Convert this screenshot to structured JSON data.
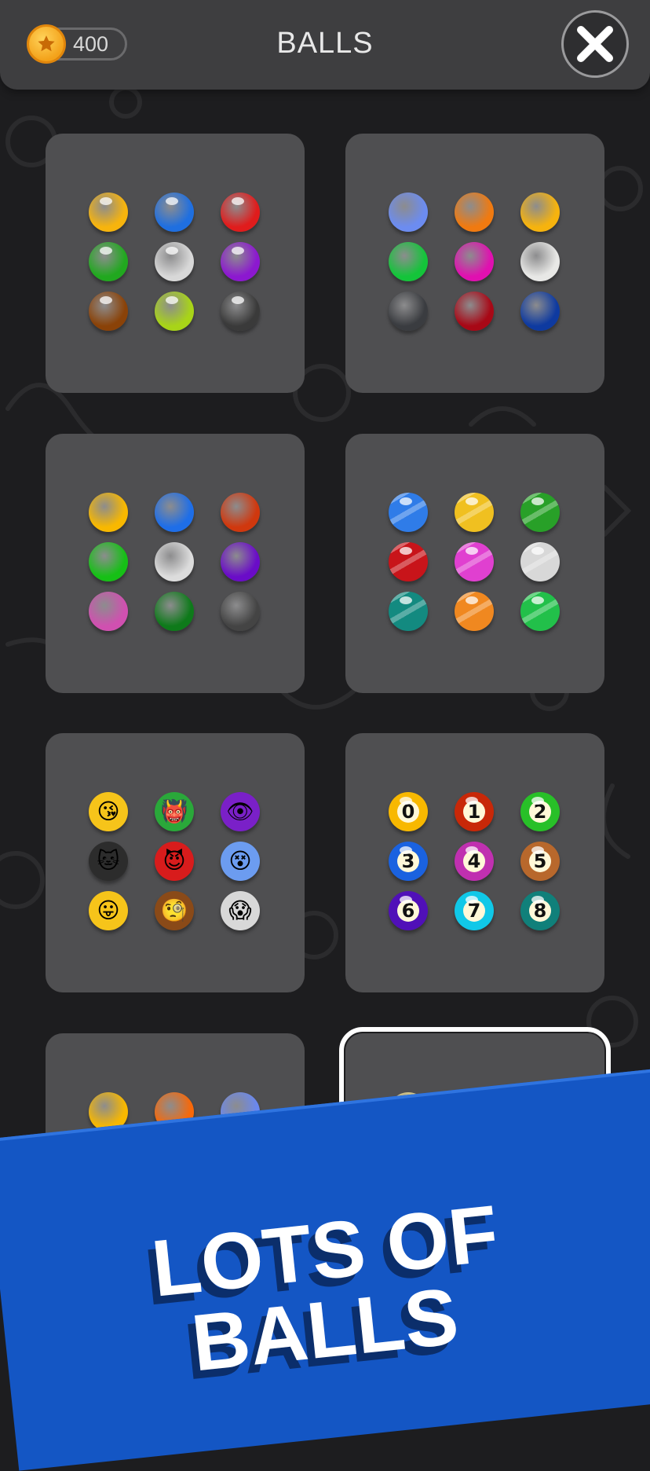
{
  "header": {
    "coins": "400",
    "title": "BALLS"
  },
  "icons": {
    "coin": "star-coin-icon",
    "close": "close-x-icon"
  },
  "ball_sets": [
    {
      "style": "glossy",
      "selected": false,
      "colors": [
        "#f7b40d",
        "#1f6fe0",
        "#e01c1c",
        "#21a81f",
        "#d8d8d8",
        "#8c18d0",
        "#8a4208",
        "#a8d418",
        "#3a3a3a"
      ]
    },
    {
      "style": "flat",
      "selected": false,
      "colors": [
        "#6c8cf0",
        "#f07a10",
        "#f6b30e",
        "#14c43a",
        "#e010b0",
        "#e8e8e6",
        "#3a3c40",
        "#a80816",
        "#0e3aa0"
      ]
    },
    {
      "style": "flat-shine",
      "selected": false,
      "colors": [
        "#f8b800",
        "#1e6ee8",
        "#d0380e",
        "#16c016",
        "#dcdcdc",
        "#6a0cc8",
        "#d050b0",
        "#0e7a1a",
        "#444444"
      ]
    },
    {
      "style": "marble",
      "selected": false,
      "colors": [
        "#2f7ce8",
        "#f0c020",
        "#28a028",
        "#c8141a",
        "#e040d0",
        "#d8d8d8",
        "#138a80",
        "#f08820",
        "#22c04a"
      ]
    },
    {
      "style": "emoji",
      "selected": false,
      "colors": [
        "#f6c41a",
        "#2aa83a",
        "#7a20c8",
        "#2c2c2c",
        "#d81c1c",
        "#6c9cf0",
        "#f6c41a",
        "#8a4a18",
        "#d8d8d8"
      ],
      "glyphs": [
        "😘",
        "👹",
        "👁",
        "🐱",
        "😈",
        "😵",
        "😛",
        "🧐",
        "😱"
      ]
    },
    {
      "style": "number",
      "selected": false,
      "colors": [
        "#f8b800",
        "#c82808",
        "#28c028",
        "#1a62e0",
        "#c030b0",
        "#b8682c",
        "#5010b8",
        "#10c8e8",
        "#10807a"
      ],
      "labels": [
        "0",
        "1",
        "2",
        "3",
        "4",
        "5",
        "6",
        "7",
        "8"
      ]
    },
    {
      "style": "flat",
      "selected": false,
      "colors": [
        "#f8b800",
        "#f86808",
        "#6a88f0",
        "#4ae82a",
        "#8c10e8",
        "#5c5c60",
        "#1aa82a",
        "#2a1aa8",
        "#eeeeee"
      ]
    },
    {
      "style": "pastel",
      "selected": true,
      "colors": [
        "#f0dc82",
        "#c44a50",
        "#4a8ac8",
        "#3a8a4a",
        "#5a5a5e",
        "#5ac8c0",
        "#888888",
        "#888888",
        "#888888"
      ]
    }
  ],
  "banner": {
    "line1": "LOTS OF",
    "line2": "BALLS",
    "color": "#1456c4"
  }
}
